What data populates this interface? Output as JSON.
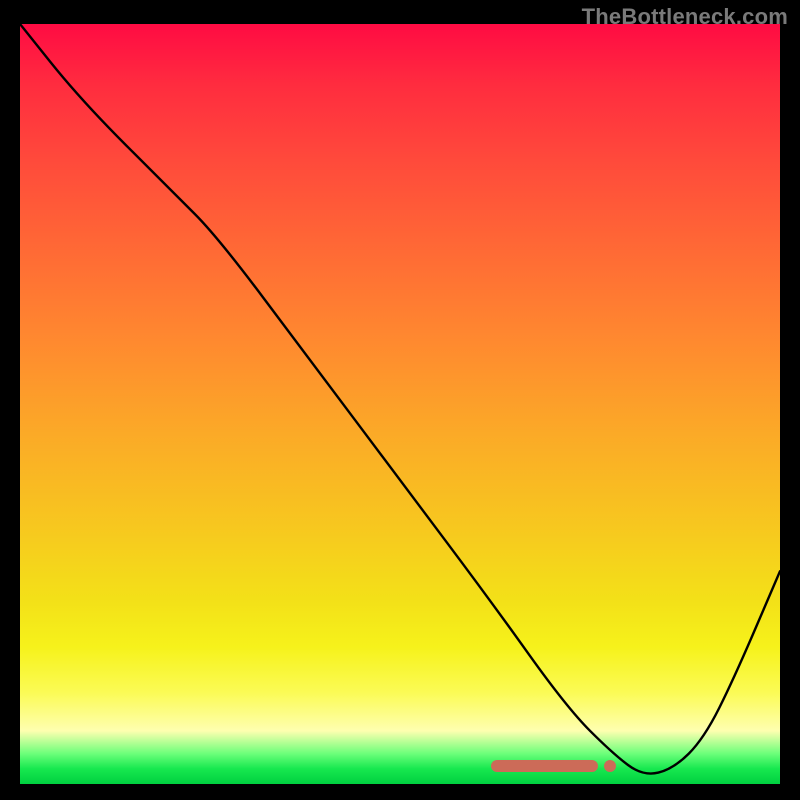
{
  "watermark": "TheBottleneck.com",
  "chart_data": {
    "type": "line",
    "title": "",
    "xlabel": "",
    "ylabel": "",
    "xlim": [
      0,
      100
    ],
    "ylim": [
      0,
      100
    ],
    "series": [
      {
        "name": "curve",
        "x": [
          0,
          8,
          20,
          26,
          38,
          50,
          62,
          72,
          78,
          82,
          86,
          90,
          94,
          100
        ],
        "values": [
          100,
          90,
          78,
          72,
          56,
          40,
          24,
          10,
          4,
          1,
          2,
          6,
          14,
          28
        ]
      }
    ],
    "marker": {
      "x_start": 62,
      "x_end": 76,
      "y": 2.4
    },
    "gradient_stops": [
      {
        "pct": 0,
        "color": "#ff0b43"
      },
      {
        "pct": 18,
        "color": "#ff4a3b"
      },
      {
        "pct": 42,
        "color": "#ff8a2f"
      },
      {
        "pct": 66,
        "color": "#f7c71f"
      },
      {
        "pct": 88,
        "color": "#fbfb56"
      },
      {
        "pct": 100,
        "color": "#00d040"
      }
    ]
  }
}
